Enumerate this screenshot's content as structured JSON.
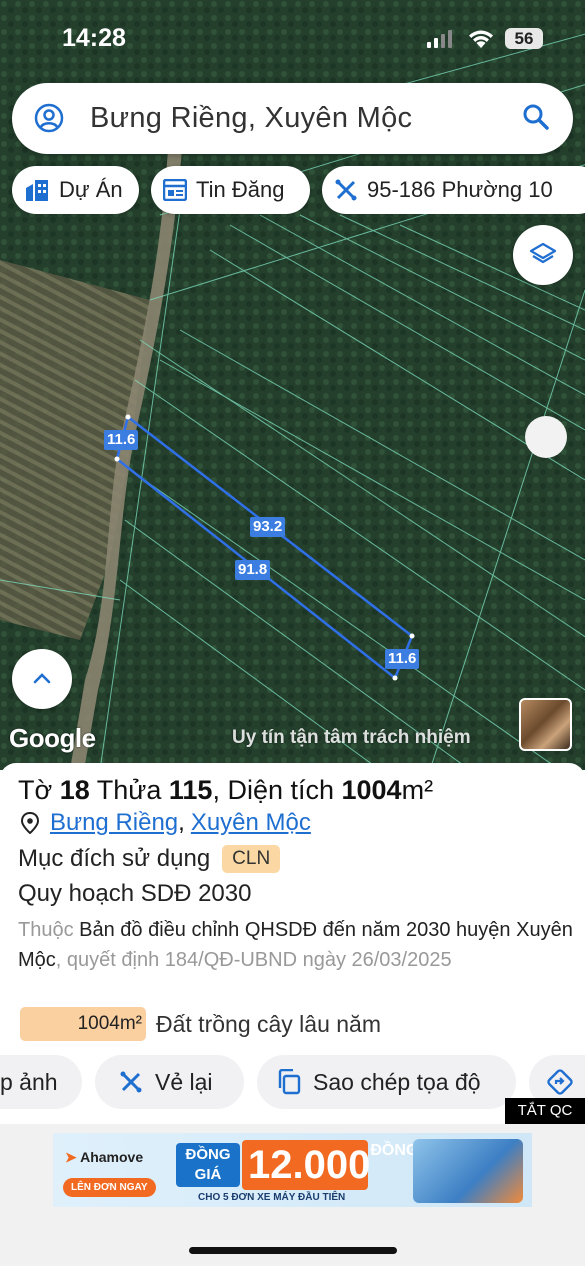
{
  "status_bar": {
    "time": "14:28",
    "battery": "56"
  },
  "search": {
    "text": "Bưng Riềng, Xuyên Mộc"
  },
  "chips": [
    {
      "label": "Dự Án",
      "icon": "building-icon"
    },
    {
      "label": "Tin Đăng",
      "icon": "listing-icon"
    },
    {
      "label": "95-186 Phường 10",
      "icon": "ruler-icon"
    }
  ],
  "map": {
    "google_label": "Google",
    "watermark": "Uy tín tận tâm trách nhiệm",
    "parcel_dimensions": {
      "top": "11.6",
      "long_top": "93.2",
      "long_bottom": "91.8",
      "bottom": "11.6"
    },
    "parcel_color": "#2f6fe8"
  },
  "parcel": {
    "title_parts": [
      "Tờ ",
      "18",
      " Thửa ",
      "115",
      ", Diện tích ",
      "1004",
      "m²"
    ],
    "address_1": "Bưng Riềng",
    "address_sep": ",",
    "address_2": "Xuyên Mộc",
    "purpose_label": "Mục đích sử dụng",
    "purpose_code": "CLN",
    "plan_label": "Quy hoạch SDĐ 2030",
    "desc_prefix": "Thuộc ",
    "desc_main": "Bản đồ điều chỉnh QHSDĐ đến năm 2030 huyện Xuyên Mộc",
    "desc_suffix": ", quyết định 184/QĐ-UBND ngày 26/03/2025",
    "area_value": "1004m²",
    "area_label": "Đất trồng cây lâu năm"
  },
  "actions": [
    {
      "label": "p ảnh"
    },
    {
      "label": "Vẻ lại",
      "icon": "ruler-icon"
    },
    {
      "label": "Sao chép tọa độ",
      "icon": "copy-icon"
    },
    {
      "label": "",
      "icon": "directions-icon"
    }
  ],
  "ads": {
    "close_label": "TẮT QC",
    "brand": "Ahamove",
    "cta": "LÊN ĐƠN NGAY",
    "promo_line1": "ĐỒNG",
    "promo_line2": "GIÁ",
    "price": "12.000",
    "price_unit": "ĐỒNG",
    "sub": "CHO 5 ĐƠN XE MÁY ĐẦU TIÊN"
  }
}
